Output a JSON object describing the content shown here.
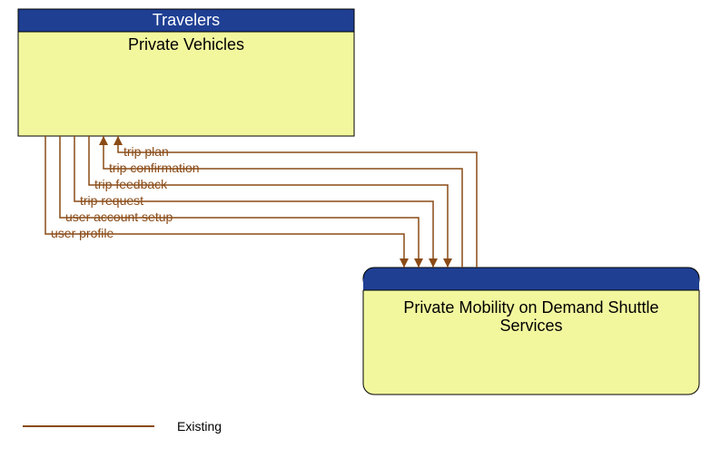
{
  "nodes": {
    "top": {
      "header": "Travelers",
      "body": "Private Vehicles"
    },
    "bottom": {
      "header": "",
      "body1": "Private Mobility on Demand Shuttle",
      "body2": "Services"
    }
  },
  "flows": [
    {
      "label": "trip plan",
      "dir": "up"
    },
    {
      "label": "trip confirmation",
      "dir": "up"
    },
    {
      "label": "trip feedback",
      "dir": "down"
    },
    {
      "label": "trip request",
      "dir": "down"
    },
    {
      "label": "user account setup",
      "dir": "down"
    },
    {
      "label": "user profile",
      "dir": "down"
    }
  ],
  "legend": {
    "label": "Existing"
  }
}
